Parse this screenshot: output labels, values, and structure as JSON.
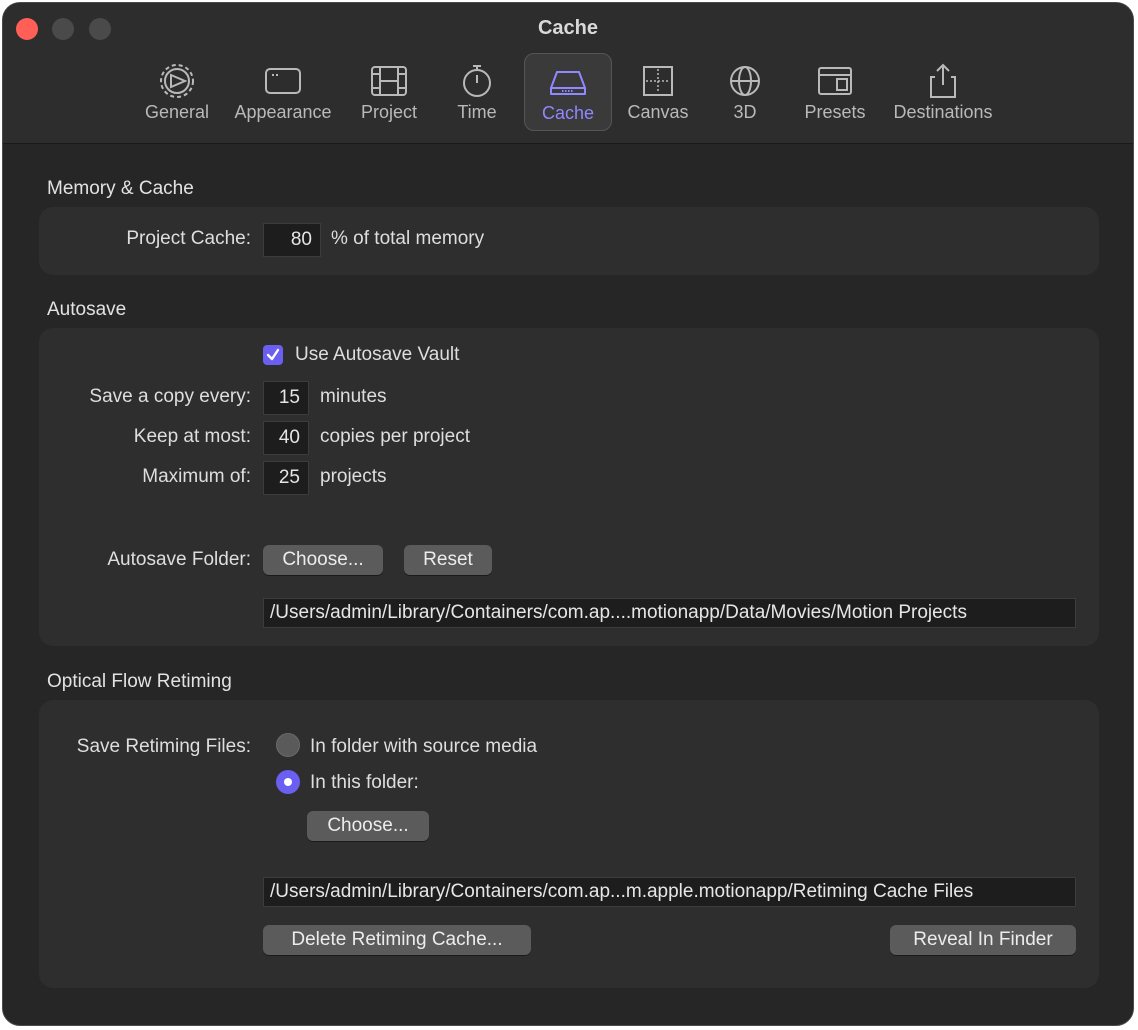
{
  "window": {
    "title": "Cache"
  },
  "tabs": [
    {
      "label": "General",
      "icon": "gear-icon"
    },
    {
      "label": "Appearance",
      "icon": "window-icon"
    },
    {
      "label": "Project",
      "icon": "film-icon"
    },
    {
      "label": "Time",
      "icon": "stopwatch-icon"
    },
    {
      "label": "Cache",
      "icon": "drive-icon"
    },
    {
      "label": "Canvas",
      "icon": "canvas-icon"
    },
    {
      "label": "3D",
      "icon": "globe-icon"
    },
    {
      "label": "Presets",
      "icon": "presets-icon"
    },
    {
      "label": "Destinations",
      "icon": "share-icon"
    }
  ],
  "active_tab": "Cache",
  "memory": {
    "title": "Memory & Cache",
    "project_cache_label": "Project Cache:",
    "project_cache_value": "80",
    "project_cache_unit": "% of total memory"
  },
  "autosave": {
    "title": "Autosave",
    "use_vault_label": "Use Autosave Vault",
    "use_vault_checked": true,
    "save_copy_label": "Save a copy every:",
    "save_copy_value": "15",
    "save_copy_unit": "minutes",
    "keep_label": "Keep at most:",
    "keep_value": "40",
    "keep_unit": "copies per project",
    "max_label": "Maximum of:",
    "max_value": "25",
    "max_unit": "projects",
    "folder_label": "Autosave Folder:",
    "choose_label": "Choose...",
    "reset_label": "Reset",
    "folder_path": "/Users/admin/Library/Containers/com.ap....motionapp/Data/Movies/Motion Projects"
  },
  "retiming": {
    "title": "Optical Flow Retiming",
    "save_label": "Save Retiming Files:",
    "option_source": "In folder with source media",
    "option_folder": "In this folder:",
    "selected": "In this folder:",
    "choose_label": "Choose...",
    "folder_path": "/Users/admin/Library/Containers/com.ap...m.apple.motionapp/Retiming Cache Files",
    "delete_label": "Delete Retiming Cache...",
    "reveal_label": "Reveal In Finder"
  },
  "colors": {
    "accent": "#6b5ff2",
    "background": "#262626",
    "panel": "#2e2e2e"
  }
}
